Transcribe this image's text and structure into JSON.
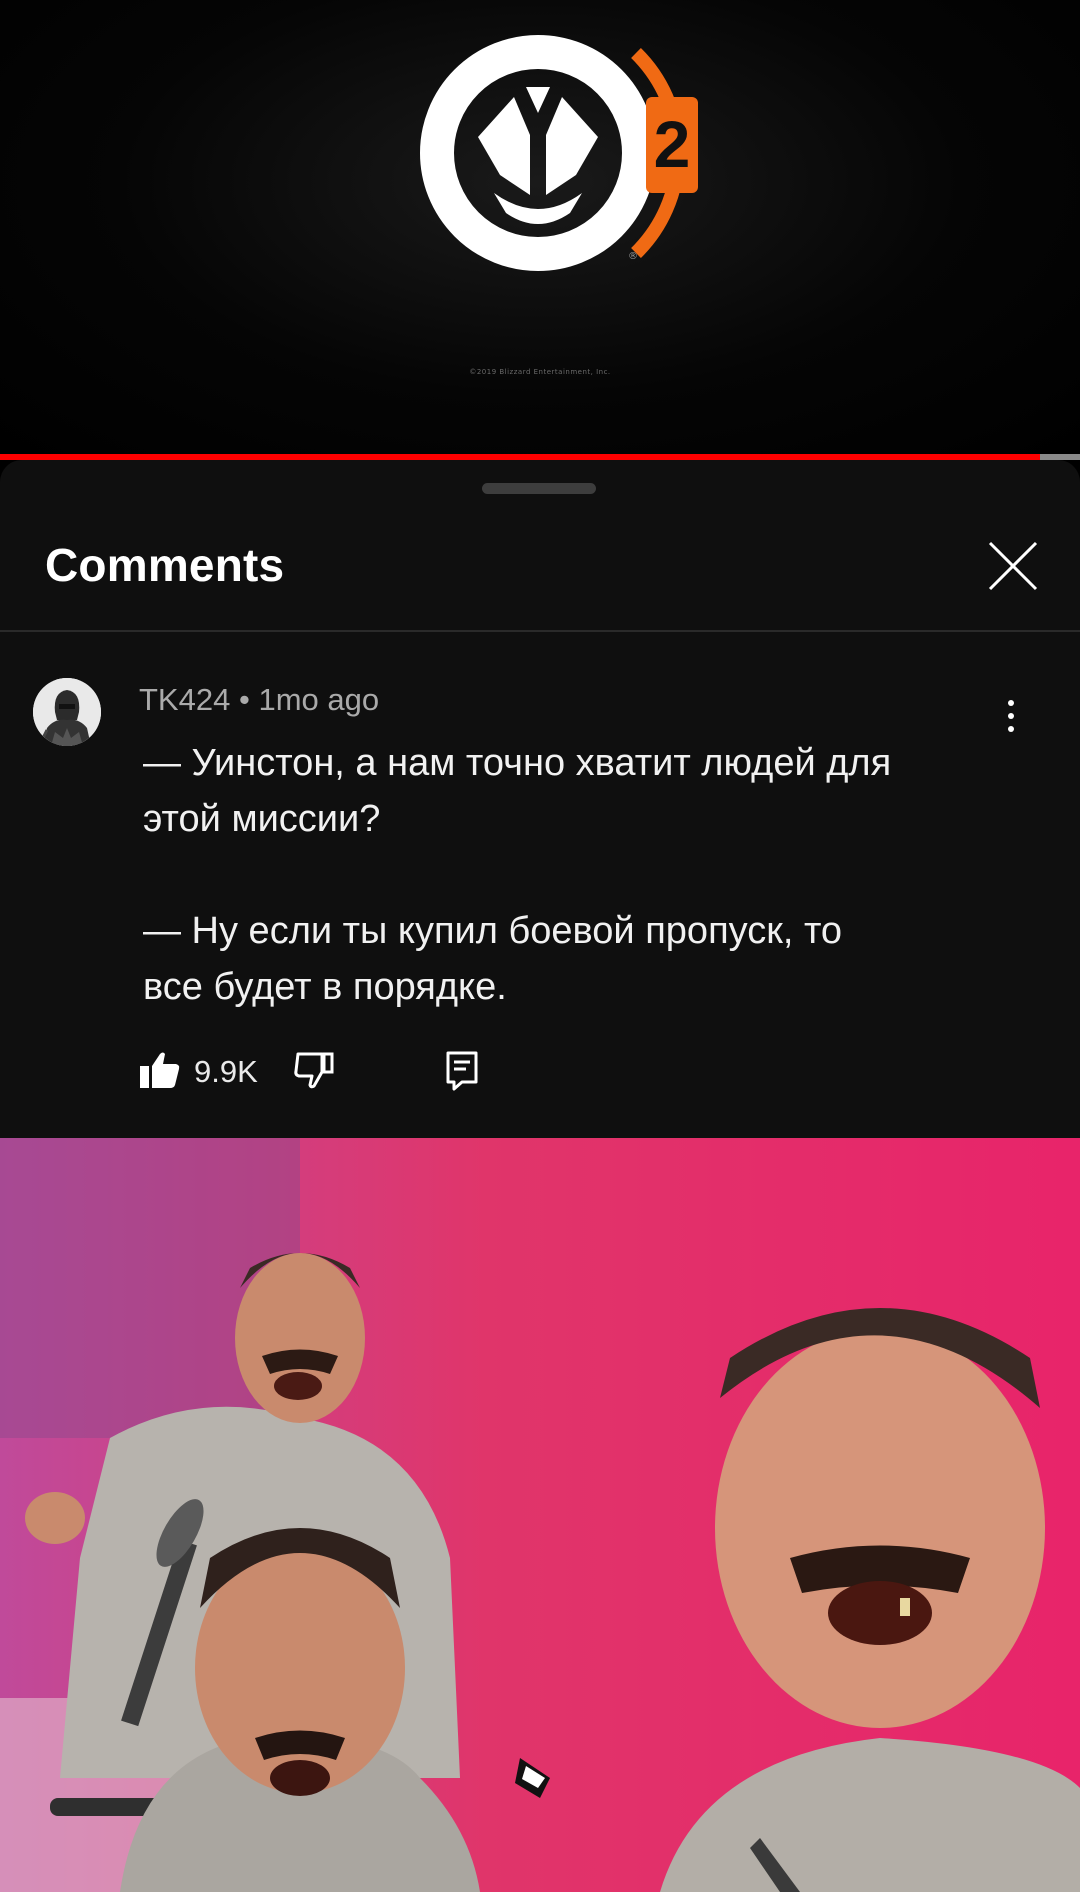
{
  "video": {
    "logo_badge": "2",
    "copyright": "©2019 Blizzard Entertainment, Inc.",
    "progress": 0.963,
    "colors": {
      "logo_white": "#ffffff",
      "logo_orange": "#f06a14",
      "progress": "#ff0000"
    }
  },
  "comments_panel": {
    "title": "Comments",
    "close_icon": "close-icon"
  },
  "comment": {
    "author": "TK424",
    "separator": "•",
    "time": "1mo ago",
    "lines": [
      "— Уинстон, а нам точно хватит людей для",
      "этой миссии?",
      "— Ну если ты купил боевой пропуск, то",
      "все будет в порядке."
    ],
    "like_count": "9.9K",
    "icons": [
      "thumbs-up-icon",
      "thumbs-down-icon",
      "reply-icon",
      "more-vert-icon"
    ]
  },
  "meme_image": {
    "subject": "laughing-man-meme",
    "colors": {
      "background": "#d8306a",
      "sweater": "#b7b3ad",
      "skin": "#c98a6d"
    }
  }
}
